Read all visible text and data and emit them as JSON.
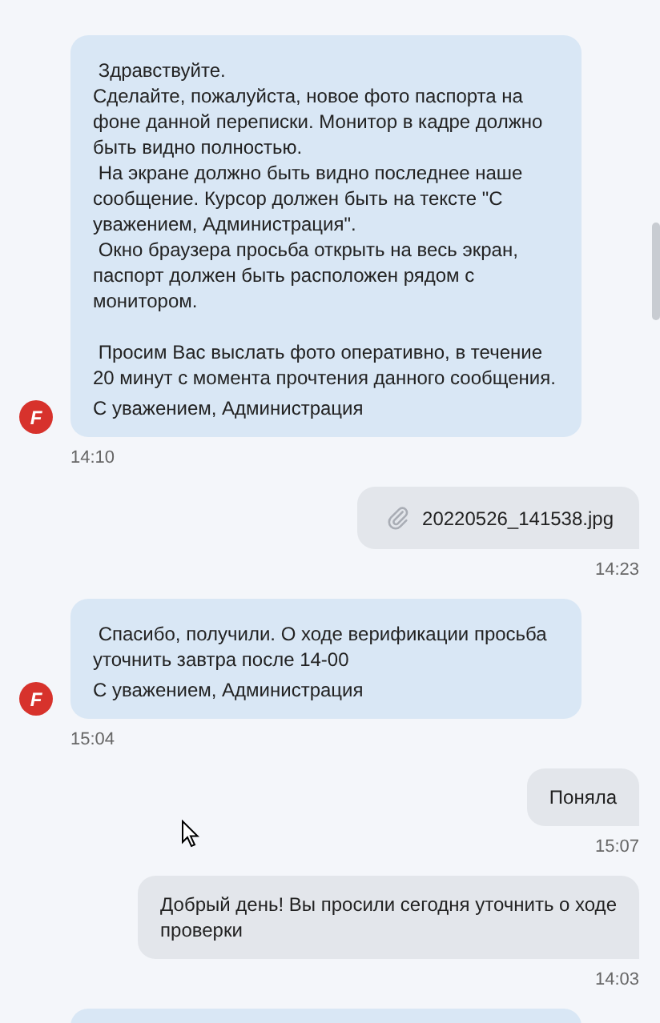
{
  "messages": [
    {
      "kind": "incoming",
      "text": " Здравствуйте.\nСделайте, пожалуйста, новое фото паспорта на\nфоне данной переписки. Монитор в кадре должно\nбыть видно полностью.\n На экране должно быть видно последнее наше\nсообщение. Курсор должен быть на тексте \"С\nуважением, Администрация\".\n Окно браузера просьба открыть на весь экран,\nпаспорт должен быть расположен рядом с\nмонитором.\n\n Просим Вас выслать фото оперативно, в течение\n20 минут с момента прочтения данного сообщения.",
      "signature": "С уважением, Администрация",
      "avatar": "F",
      "time": "14:10"
    },
    {
      "kind": "attachment",
      "text": "20220526_141538.jpg",
      "time": "14:23"
    },
    {
      "kind": "incoming",
      "text": " Спасибо, получили. О ходе верификации просьба\nуточнить завтра после 14-00",
      "signature": "С уважением, Администрация",
      "avatar": "F",
      "time": "15:04"
    },
    {
      "kind": "outgoing",
      "text": "Поняла",
      "time": "15:07"
    },
    {
      "kind": "outgoing",
      "text": "Добрый день! Вы просили сегодня уточнить о ходе\nпроверки",
      "time": "14:03"
    },
    {
      "kind": "partial"
    }
  ]
}
